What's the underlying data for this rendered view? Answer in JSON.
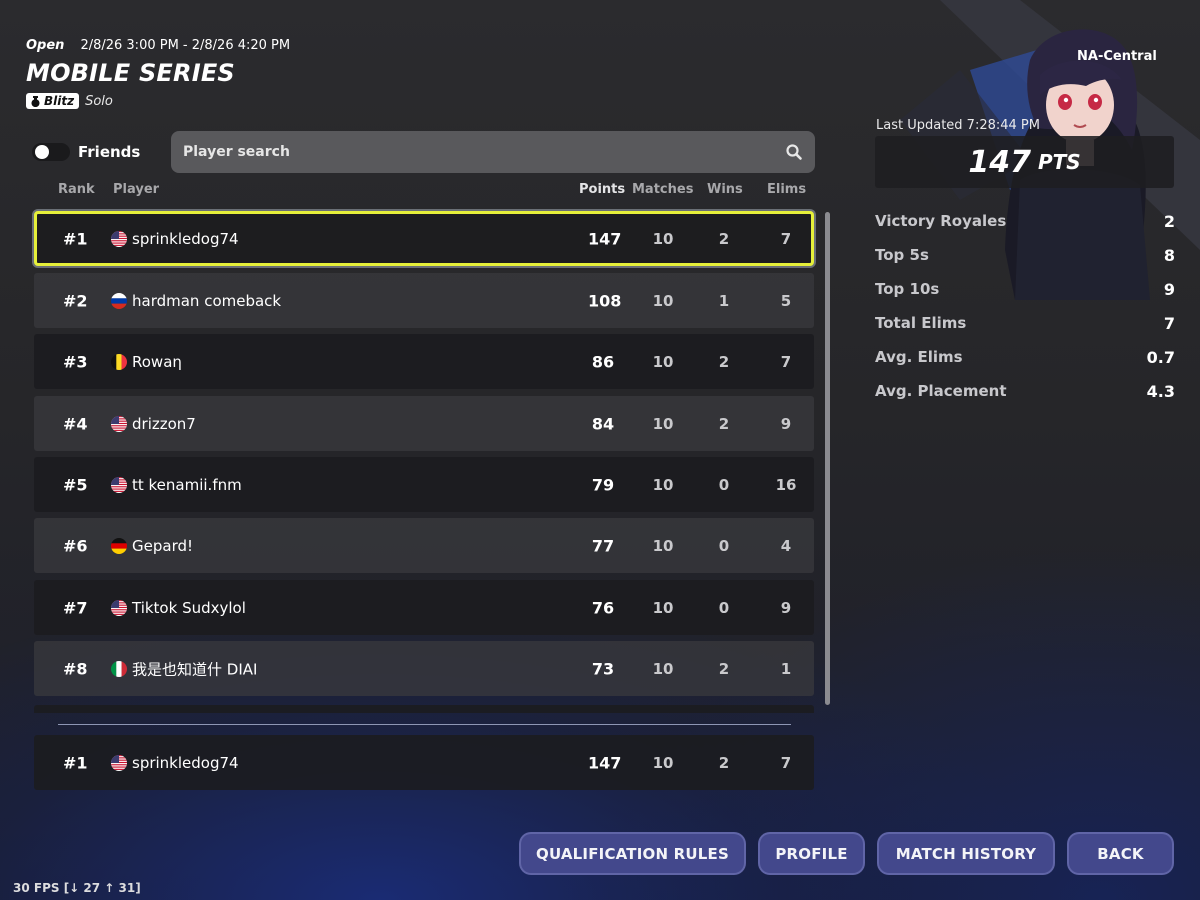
{
  "header": {
    "status": "Open",
    "date_range": "2/8/26 3:00 PM - 2/8/26 4:20 PM",
    "title": "MOBILE SERIES",
    "mode_badge": "Blitz",
    "mode_type": "Solo"
  },
  "filters": {
    "friends_label": "Friends",
    "friends_toggle_on": false,
    "search_placeholder": "Player search"
  },
  "table": {
    "columns": [
      "Rank",
      "Player",
      "Points",
      "Matches",
      "Wins",
      "Elims"
    ],
    "rows": [
      {
        "rank": "#1",
        "flag": "us",
        "player": "sprinkledog74",
        "points": "147",
        "matches": "10",
        "wins": "2",
        "elims": "7",
        "selected": true
      },
      {
        "rank": "#2",
        "flag": "ru",
        "player": "hardman comeback",
        "points": "108",
        "matches": "10",
        "wins": "1",
        "elims": "5"
      },
      {
        "rank": "#3",
        "flag": "be",
        "player": "Rowaη",
        "points": "86",
        "matches": "10",
        "wins": "2",
        "elims": "7"
      },
      {
        "rank": "#4",
        "flag": "us",
        "player": "drizzon7",
        "points": "84",
        "matches": "10",
        "wins": "2",
        "elims": "9"
      },
      {
        "rank": "#5",
        "flag": "us",
        "player": "tt kenamii.fnm",
        "points": "79",
        "matches": "10",
        "wins": "0",
        "elims": "16"
      },
      {
        "rank": "#6",
        "flag": "de",
        "player": "Gepard!",
        "points": "77",
        "matches": "10",
        "wins": "0",
        "elims": "4"
      },
      {
        "rank": "#7",
        "flag": "us",
        "player": "Tiktok Sudxylol",
        "points": "76",
        "matches": "10",
        "wins": "0",
        "elims": "9"
      },
      {
        "rank": "#8",
        "flag": "it",
        "player": "我是也知道什 DIAI",
        "points": "73",
        "matches": "10",
        "wins": "2",
        "elims": "1"
      }
    ],
    "my_row": {
      "rank": "#1",
      "flag": "us",
      "player": "sprinkledog74",
      "points": "147",
      "matches": "10",
      "wins": "2",
      "elims": "7"
    }
  },
  "player_panel": {
    "region": "NA-Central",
    "last_updated": "Last Updated 7:28:44 PM",
    "points_value": "147",
    "points_unit": "PTS",
    "stats": [
      {
        "label": "Victory Royales",
        "value": "2"
      },
      {
        "label": "Top 5s",
        "value": "8"
      },
      {
        "label": "Top 10s",
        "value": "9"
      },
      {
        "label": "Total Elims",
        "value": "7"
      },
      {
        "label": "Avg. Elims",
        "value": "0.7"
      },
      {
        "label": "Avg. Placement",
        "value": "4.3"
      }
    ]
  },
  "buttons": {
    "qualification_rules": "QUALIFICATION RULES",
    "profile": "PROFILE",
    "match_history": "MATCH HISTORY",
    "back": "BACK"
  },
  "fps_readout": "30 FPS [↓ 27 ↑ 31]",
  "colors": {
    "selection_outline": "#e6f03a",
    "button_bg": "#43488c",
    "row_dark": "#1c1c1f",
    "row_light": "#3a3a3e"
  }
}
